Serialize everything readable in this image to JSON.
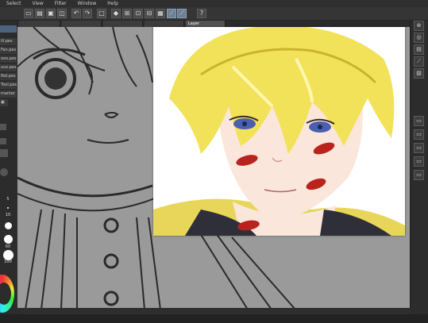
{
  "menu": [
    "Select",
    "View",
    "Filter",
    "Window",
    "Help"
  ],
  "canvas_tabs": [
    "",
    "",
    "",
    "",
    "Layer"
  ],
  "left_panel": {
    "items": [
      "",
      "ill.pes",
      "Fan.pes",
      "ooo.pes",
      "uce.pes",
      "fbd.pes",
      "Tool.pes",
      "marker"
    ],
    "brush_sizes": [
      "5",
      "10",
      "",
      "60",
      "100"
    ]
  },
  "status_bar": [
    "",
    ""
  ],
  "colors": {
    "accent": "#5b7fa6",
    "lips": "#b8231e",
    "hair": "#f2e25a",
    "eyes": "#4a5fb0"
  }
}
